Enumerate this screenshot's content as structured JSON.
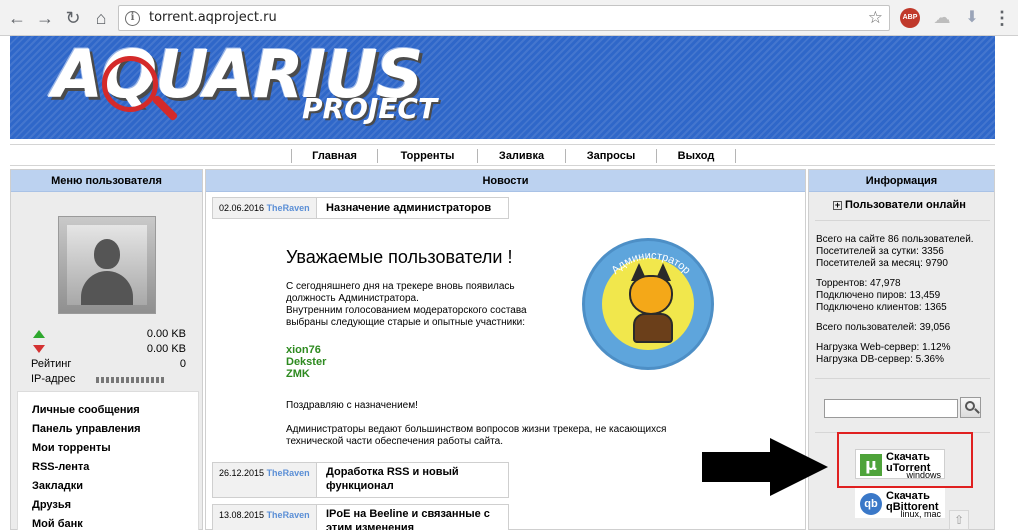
{
  "browser": {
    "url": "torrent.aqproject.ru"
  },
  "site": {
    "logo_main": "AQUARIUS",
    "logo_sub": "PROJECT",
    "nav": [
      "Главная",
      "Торренты",
      "Заливка",
      "Запросы",
      "Выход"
    ]
  },
  "left_panel": {
    "title": "Меню пользователя",
    "upload_value": "0.00 KB",
    "download_value": "0.00 KB",
    "rating_label": "Рейтинг",
    "rating_value": "0",
    "ip_label": "IP-адрес",
    "menu": [
      "Личные сообщения",
      "Панель управления",
      "Мои торренты",
      "RSS-лента",
      "Закладки",
      "Друзья",
      "Мой банк"
    ]
  },
  "center_panel": {
    "title": "Новости",
    "news": [
      {
        "date": "02.06.2016",
        "author": "TheRaven",
        "title": "Назначение администраторов"
      },
      {
        "date": "26.12.2015",
        "author": "TheRaven",
        "title_line1": "Доработка RSS и новый",
        "title_line2": "функционал"
      },
      {
        "date": "13.08.2015",
        "author": "TheRaven",
        "title_line1": "IPoE на Beeline и связанные с",
        "title_line2": "этим изменения"
      }
    ],
    "article": {
      "heading": "Уважаемые пользователи !",
      "p1": [
        "С сегодняшнего дня на трекере вновь появилась",
        "должность Администратора.",
        "Внутренним голосованием модераторского состава",
        "выбраны следующие старые и опытные участники:"
      ],
      "names": [
        "xion76",
        "Dekster",
        "ZMK"
      ],
      "p2": "Поздравляю с назначением!",
      "p3": [
        "Администраторы ведают большинством вопросов жизни трекера, не касающихся",
        "технической части обеспечения работы сайта."
      ],
      "badge_text": "Администратор"
    }
  },
  "right_panel": {
    "title": "Информация",
    "online_label": "Пользователи онлайн",
    "stats_group1": [
      "Всего на сайте 86 пользователей.",
      "Посетителей за сутки: 3356",
      "Посетителей за месяц: 9790"
    ],
    "stats_group2": [
      "Торрентов: 47,978",
      "Подключено пиров: 13,459",
      "Подключено клиентов: 1365"
    ],
    "stats_group3": [
      "Всего пользователей: 39,056"
    ],
    "stats_group4": [
      "Нагрузка Web-сервер: 1.12%",
      "Нагрузка DB-сервер: 5.36%"
    ],
    "downloads": [
      {
        "line1": "Скачать",
        "line2": "uTorrent",
        "platform": "windows"
      },
      {
        "line1": "Скачать",
        "line2": "qBittorent",
        "platform": "linux, mac"
      }
    ]
  }
}
